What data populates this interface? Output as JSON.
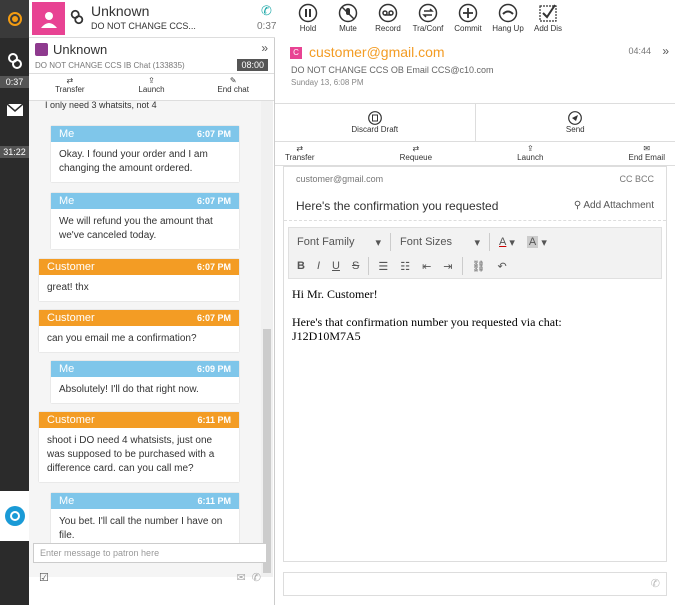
{
  "rail": {
    "timers": [
      "0:37",
      "31:22"
    ]
  },
  "header": {
    "name": "Unknown",
    "sub": "DO NOT CHANGE CCS...",
    "timer": "0:37"
  },
  "toolbar": [
    {
      "label": "Hold",
      "icon": "pause-icon"
    },
    {
      "label": "Mute",
      "icon": "mute-icon"
    },
    {
      "label": "Record",
      "icon": "record-icon"
    },
    {
      "label": "Tra/Conf",
      "icon": "transfer-icon"
    },
    {
      "label": "Commit",
      "icon": "plus-icon"
    },
    {
      "label": "Hang Up",
      "icon": "hangup-icon"
    },
    {
      "label": "Add Dis",
      "icon": "checklist-icon"
    }
  ],
  "chat": {
    "title": "Unknown",
    "sub": "DO NOT CHANGE CCS IB Chat (133835)",
    "timer": "08:00",
    "actions": [
      "Transfer",
      "Launch",
      "End chat"
    ],
    "partial_text": "I only need 3 whatsits, not 4",
    "messages": [
      {
        "who": "Me",
        "time": "6:07 PM",
        "text": "Okay. I found your order and I am changing the amount ordered."
      },
      {
        "who": "Me",
        "time": "6:07 PM",
        "text": "We will refund you the amount that we've canceled today."
      },
      {
        "who": "Customer",
        "time": "6:07 PM",
        "text": "great! thx"
      },
      {
        "who": "Customer",
        "time": "6:07 PM",
        "text": "can you email me a confirmation?"
      },
      {
        "who": "Me",
        "time": "6:09 PM",
        "text": "Absolutely! I'll do that right now."
      },
      {
        "who": "Customer",
        "time": "6:11 PM",
        "text": "shoot i DO need 4 whatsists, just one was supposed to be purchased with a difference card. can you call me?"
      },
      {
        "who": "Me",
        "time": "6:11 PM",
        "text": "You bet. I'll call the number I have on file."
      }
    ],
    "compose_placeholder": "Enter message to patron here"
  },
  "email": {
    "icon_letter": "C",
    "title": "customer@gmail.com",
    "sub": "DO NOT CHANGE CCS OB Email  CCS@c10.com",
    "date": "Sunday 13, 6:08 PM",
    "time": "04:44",
    "actions": [
      "Discard Draft",
      "Send"
    ],
    "actions2": [
      "Transfer",
      "Requeue",
      "Launch",
      "End Email"
    ],
    "to": "customer@gmail.com",
    "cc": "CC BCC",
    "subject": "Here's the confirmation you requested",
    "attach": "Add Attachment",
    "font_family": "Font Family",
    "font_sizes": "Font Sizes",
    "body": [
      "Hi Mr. Customer!",
      "",
      "Here's that confirmation number you requested via chat:",
      "J12D10M7A5"
    ]
  },
  "colors": {
    "me": "#7fc6ea",
    "customer": "#f39c24",
    "rail": "#2b2b2b"
  }
}
